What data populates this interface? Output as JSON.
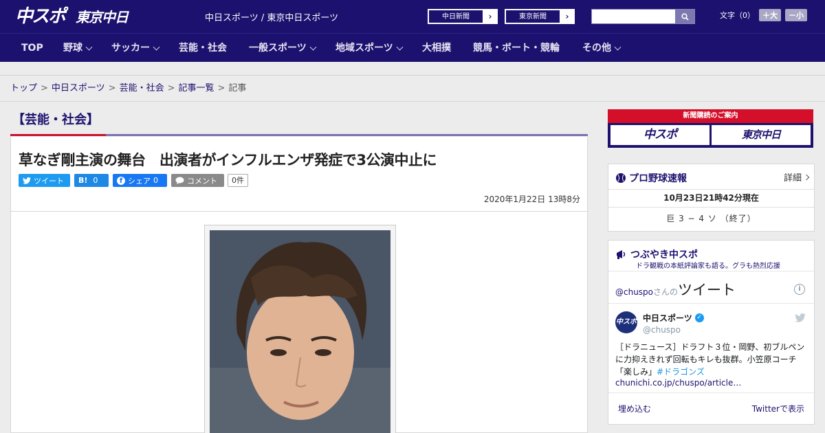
{
  "header": {
    "logo_chuspo": "中スポ",
    "logo_tokyo": "東京中日",
    "site_links": "中日スポーツ / 東京中日スポーツ",
    "paper_buttons": [
      "中日新聞",
      "東京新聞"
    ],
    "font_size_label": "文字（0）",
    "font_larger": "＋大",
    "font_smaller": "－小"
  },
  "nav": {
    "items": [
      {
        "label": "TOP"
      },
      {
        "label": "野球"
      },
      {
        "label": "サッカー"
      },
      {
        "label": "芸能・社会"
      },
      {
        "label": "一般スポーツ"
      },
      {
        "label": "地域スポーツ"
      },
      {
        "label": "大相撲"
      },
      {
        "label": "競馬・ボート・競輪"
      },
      {
        "label": "その他"
      }
    ]
  },
  "breadcrumb": {
    "items": [
      "トップ",
      "中日スポーツ",
      "芸能・社会",
      "記事一覧"
    ],
    "current": "記事",
    "separator": ">"
  },
  "category_title": "【芸能・社会】",
  "article": {
    "headline": "草なぎ剛主演の舞台　出演者がインフルエンザ発症で3公演中止に",
    "share": {
      "tweet": "ツイート",
      "hatena": "B!",
      "hatena_count": "0",
      "facebook": "シェア",
      "facebook_count": "0",
      "comment": "コメント",
      "comment_count": "0件"
    },
    "date": "2020年1月22日 13時8分"
  },
  "sidebar": {
    "subscribe": {
      "top": "新聞購読のご案内",
      "left": "中スポ",
      "right": "東京中日"
    },
    "pro_baseball": {
      "title": "プロ野球速報",
      "detail": "詳細",
      "time": "10月23日21時42分現在",
      "score": "巨 3 − 4 ソ （終了）"
    },
    "twitter": {
      "title": "つぶやき中スポ",
      "subtitle": "ドラ観戦の本紙評論家も語る。グラも熱烈応援",
      "handle_prefix": "@chuspo",
      "san_no": "さんの",
      "tweets_word": "ツイート",
      "account_name": "中日スポーツ",
      "account_handle": "@chuspo",
      "avatar_text": "中スポ",
      "tweet_text": "［ドラニュース］ドラフト３位・岡野、初ブルペンに力抑えきれず回転もキレも抜群。小笠原コーチ「楽しみ」",
      "tweet_hashtag": "#ドラゴンズ",
      "tweet_link": "chunichi.co.jp/chuspo/article…",
      "embed": "埋め込む",
      "view_on": "Twitterで表示"
    }
  }
}
